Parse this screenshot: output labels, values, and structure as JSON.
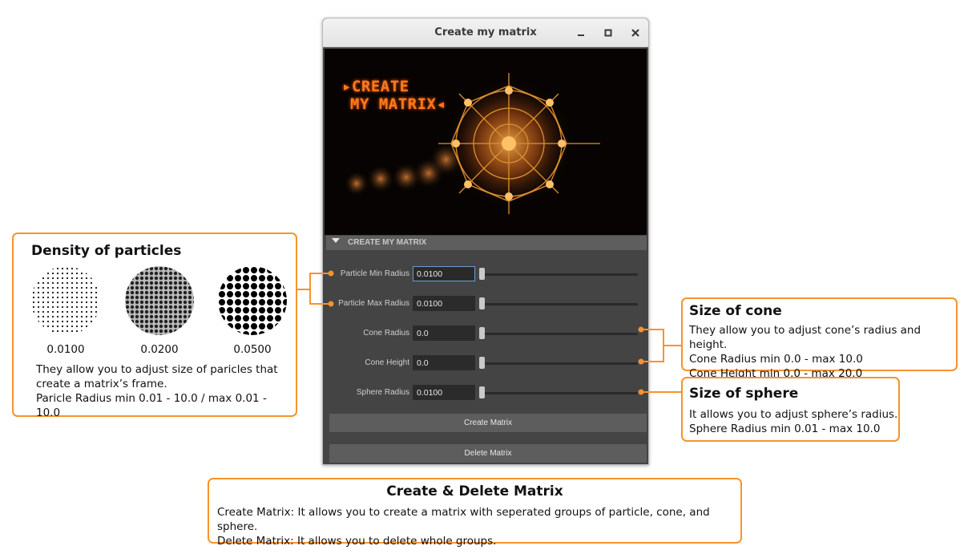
{
  "window": {
    "title": "Create my matrix",
    "banner_line1": "▸CREATE",
    "banner_line2": "MY MATRIX◂",
    "section_header": "CREATE MY MATRIX",
    "fields": [
      {
        "label": "Particle Min Radius",
        "value": "0.0100"
      },
      {
        "label": "Particle Max Radius",
        "value": "0.0100"
      },
      {
        "label": "Cone Radius",
        "value": "0.0"
      },
      {
        "label": "Cone Height",
        "value": "0.0"
      },
      {
        "label": "Sphere Radius",
        "value": "0.0100"
      }
    ],
    "create_button": "Create Matrix",
    "delete_button": "Delete Matrix",
    "icons": {
      "minimize": "minimize-icon",
      "maximize": "maximize-icon",
      "close": "close-icon"
    }
  },
  "density": {
    "title": "Density of particles",
    "samples": [
      "0.0100",
      "0.0200",
      "0.0500"
    ],
    "desc_line1": "They allow you to adjust size of paricles that",
    "desc_line2": "create a matrix’s frame.",
    "desc_line3": "Paricle Radius min 0.01 - 10.0 / max 0.01 - 10.0"
  },
  "cone": {
    "title": "Size of cone",
    "line1": "They allow you to adjust cone’s radius and height.",
    "line2": "Cone Radius min 0.0 - max 10.0",
    "line3": "Cone Height min 0.0 - max 20.0"
  },
  "sphere": {
    "title": "Size of sphere",
    "line1": "It allows you to adjust sphere’s radius.",
    "line2": "Sphere Radius min 0.01 - max 10.0"
  },
  "create_delete": {
    "title": "Create & Delete Matrix",
    "line1": "Create Matrix: It allows you to create a matrix with seperated groups of particle, cone, and sphere.",
    "line2": "Delete Matrix: It allows you to delete whole groups."
  },
  "colors": {
    "accent": "#f7932d",
    "panel": "#444444",
    "field": "#2b2b2b"
  }
}
